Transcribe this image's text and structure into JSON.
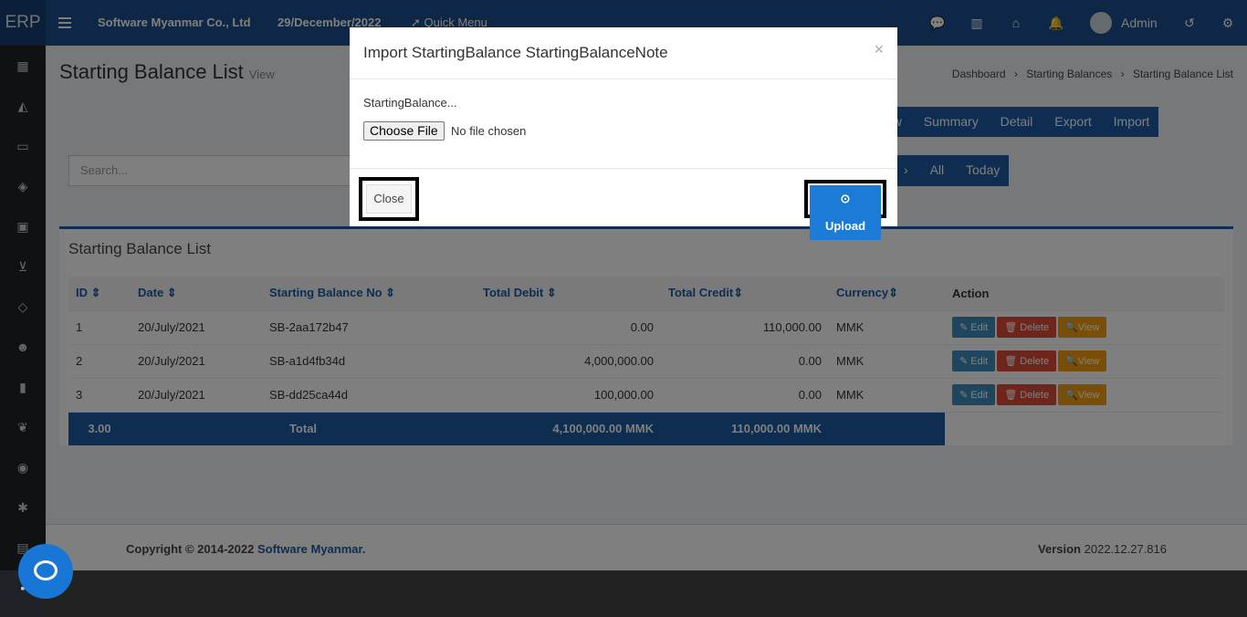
{
  "topbar": {
    "logo": "ERP",
    "company": "Software Myanmar Co., Ltd",
    "date": "29/December/2022",
    "quick_menu": "Quick Menu",
    "user": "Admin"
  },
  "page": {
    "title": "Starting Balance List",
    "subtitle": "View",
    "breadcrumb": [
      "Dashboard",
      "Starting Balances",
      "Starting Balance List"
    ]
  },
  "actions": [
    "ew",
    "Summary",
    "Detail",
    "Export",
    "Import"
  ],
  "search": {
    "placeholder": "Search..."
  },
  "filters": [
    "›",
    "All",
    "Today"
  ],
  "list": {
    "title": "Starting Balance List",
    "columns": [
      "ID",
      "Date",
      "Starting Balance No",
      "Total Debit",
      "Total Credit",
      "Currency",
      "Action"
    ],
    "rows": [
      {
        "id": "1",
        "date": "20/July/2021",
        "no": "SB-2aa172b47",
        "debit": "0.00",
        "credit": "110,000.00",
        "currency": "MMK"
      },
      {
        "id": "2",
        "date": "20/July/2021",
        "no": "SB-a1d4fb34d",
        "debit": "4,000,000.00",
        "credit": "0.00",
        "currency": "MMK"
      },
      {
        "id": "3",
        "date": "20/July/2021",
        "no": "SB-dd25ca44d",
        "debit": "100,000.00",
        "credit": "0.00",
        "currency": "MMK"
      }
    ],
    "total": {
      "count": "3.00",
      "label": "Total",
      "debit": "4,100,000.00 MMK",
      "credit": "110,000.00 MMK"
    },
    "row_actions": {
      "edit": "Edit",
      "delete": "Delete",
      "view": "View"
    }
  },
  "footer": {
    "copyright": "Copyright © 2014-2022",
    "company": "Software Myanmar.",
    "version_label": "Version",
    "version": "2022.12.27.816"
  },
  "modal": {
    "title": "Import StartingBalance StartingBalanceNote",
    "close_x": "×",
    "label": "StartingBalance...",
    "file_button": "Choose File",
    "file_status": "No file chosen",
    "close_button": "Close",
    "upload_button": "Upload"
  }
}
